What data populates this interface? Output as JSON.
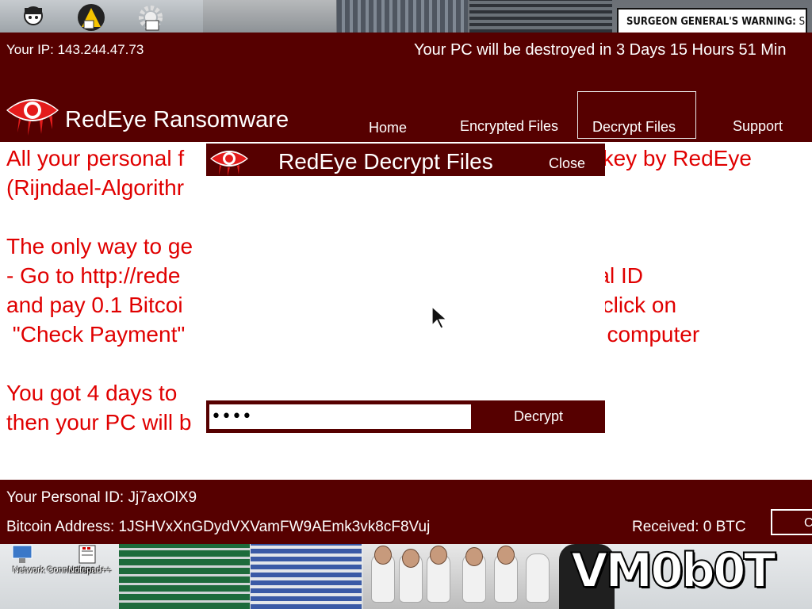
{
  "desktop": {
    "warning_sign_bold": "SURGEON GENERAL'S WARNING:",
    "warning_sign_rest": " Smoking",
    "watermark": "VM0b0T",
    "icons": [
      {
        "label": "Network Connections",
        "icon": "network-icon"
      },
      {
        "label": "Notepad++",
        "icon": "notepad-icon"
      }
    ]
  },
  "window": {
    "ip_text": "Your IP: 143.244.47.73",
    "countdown_text": "Your PC will be destroyed in 3 Days 15 Hours 51 Min",
    "brand": "RedEye Ransomware",
    "nav": {
      "home": "Home",
      "encrypted": "Encrypted Files",
      "decrypt": "Decrypt Files",
      "support": "Support"
    },
    "message": "All your personal f                                                      y strong key by RedEye\n(Rijndael-Algorithr\n\nThe only way to ge\n- Go to http://rede                                                  our Personal ID\nand pay 0.1 Bitcoi                                                  ou need to click on\n \"Check Payment\"                                                 unlock your computer\n\nYou got 4 days to\nthen your PC will b",
    "footer": {
      "personal_id": "Your Personal ID: Jj7axOlX9",
      "bitcoin_address": "Bitcoin Address: 1JSHVxXnGDydVXVamFW9AEmk3vk8cF8Vuj",
      "received": "Received: 0 BTC",
      "check_button": "C"
    }
  },
  "dialog": {
    "title": "RedEye Decrypt Files",
    "close": "Close",
    "password_value": "••••",
    "decrypt_button": "Decrypt"
  },
  "colors": {
    "dark_red": "#560000",
    "message_red": "#e00000"
  }
}
